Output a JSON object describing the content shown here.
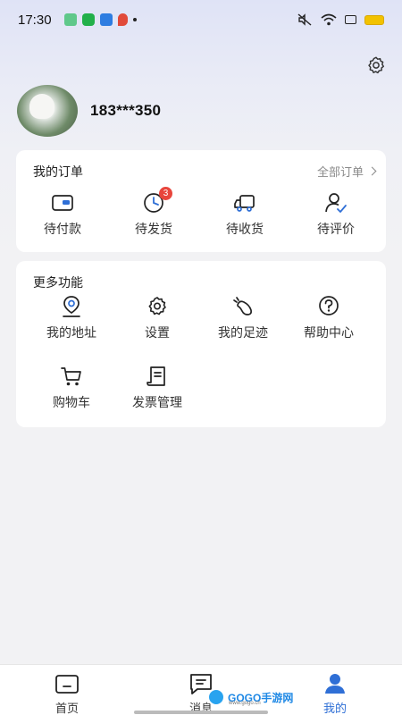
{
  "status_bar": {
    "time": "17:30",
    "icons": [
      "download-icon",
      "wechat-icon",
      "cloud-icon",
      "location-icon",
      "dot",
      "mute-icon",
      "wifi-icon",
      "sim-icon",
      "battery-icon"
    ]
  },
  "profile": {
    "phone": "183***350"
  },
  "orders": {
    "title": "我的订单",
    "all_label": "全部订单",
    "items": [
      {
        "label": "待付款",
        "icon": "wallet-icon"
      },
      {
        "label": "待发货",
        "icon": "clock-icon",
        "badge": "3"
      },
      {
        "label": "待收货",
        "icon": "truck-icon"
      },
      {
        "label": "待评价",
        "icon": "user-check-icon"
      }
    ]
  },
  "more": {
    "title": "更多功能",
    "items": [
      {
        "label": "我的地址",
        "icon": "address-pin-icon"
      },
      {
        "label": "设置",
        "icon": "gear-icon"
      },
      {
        "label": "我的足迹",
        "icon": "footprint-icon"
      },
      {
        "label": "帮助中心",
        "icon": "help-icon"
      },
      {
        "label": "购物车",
        "icon": "cart-icon"
      },
      {
        "label": "发票管理",
        "icon": "invoice-icon"
      }
    ]
  },
  "tabbar": {
    "tabs": [
      {
        "label": "首页",
        "icon": "home-icon"
      },
      {
        "label": "消息",
        "icon": "message-icon"
      },
      {
        "label": "我的",
        "icon": "profile-icon",
        "active": true
      }
    ]
  },
  "watermark": {
    "text": "GOGO手游网",
    "sub": "www.gogo.cn"
  },
  "colors": {
    "accent": "#2f6fd6",
    "badge": "#e8453c",
    "battery": "#f2c200"
  }
}
